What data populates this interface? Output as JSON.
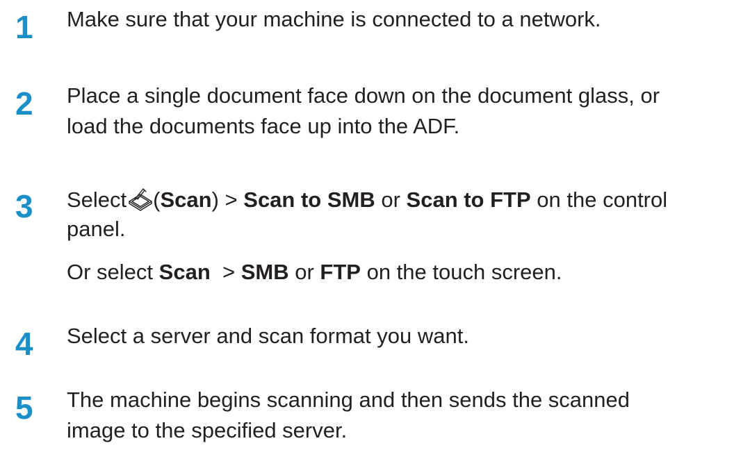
{
  "steps": [
    {
      "number": "1",
      "lines": [
        "Make sure that your machine is connected to a network."
      ]
    },
    {
      "number": "2",
      "lines": [
        "Place a single document face down on the document glass, or",
        "load the documents face up into the ADF."
      ]
    },
    {
      "number": "3",
      "line1": {
        "select": "Select",
        "open_paren": "(",
        "scan": "Scan",
        "close_sep": ") > ",
        "scan_to_smb": "Scan to SMB",
        "or": " or ",
        "scan_to_ftp": "Scan to FTP",
        "tail": " on the control"
      },
      "line2": "panel.",
      "alt": {
        "lead": "Or select ",
        "scan": "Scan",
        "sep": "  > ",
        "smb": "SMB",
        "or": " or ",
        "ftp": "FTP",
        "tail": " on the touch screen."
      },
      "icon": "scanner-icon"
    },
    {
      "number": "4",
      "lines": [
        "Select a server and scan format you want."
      ]
    },
    {
      "number": "5",
      "lines": [
        "The machine begins scanning and then sends the scanned",
        "image to the specified server."
      ]
    }
  ],
  "colors": {
    "step_number": "#1a8fc8",
    "text": "#231f20"
  }
}
